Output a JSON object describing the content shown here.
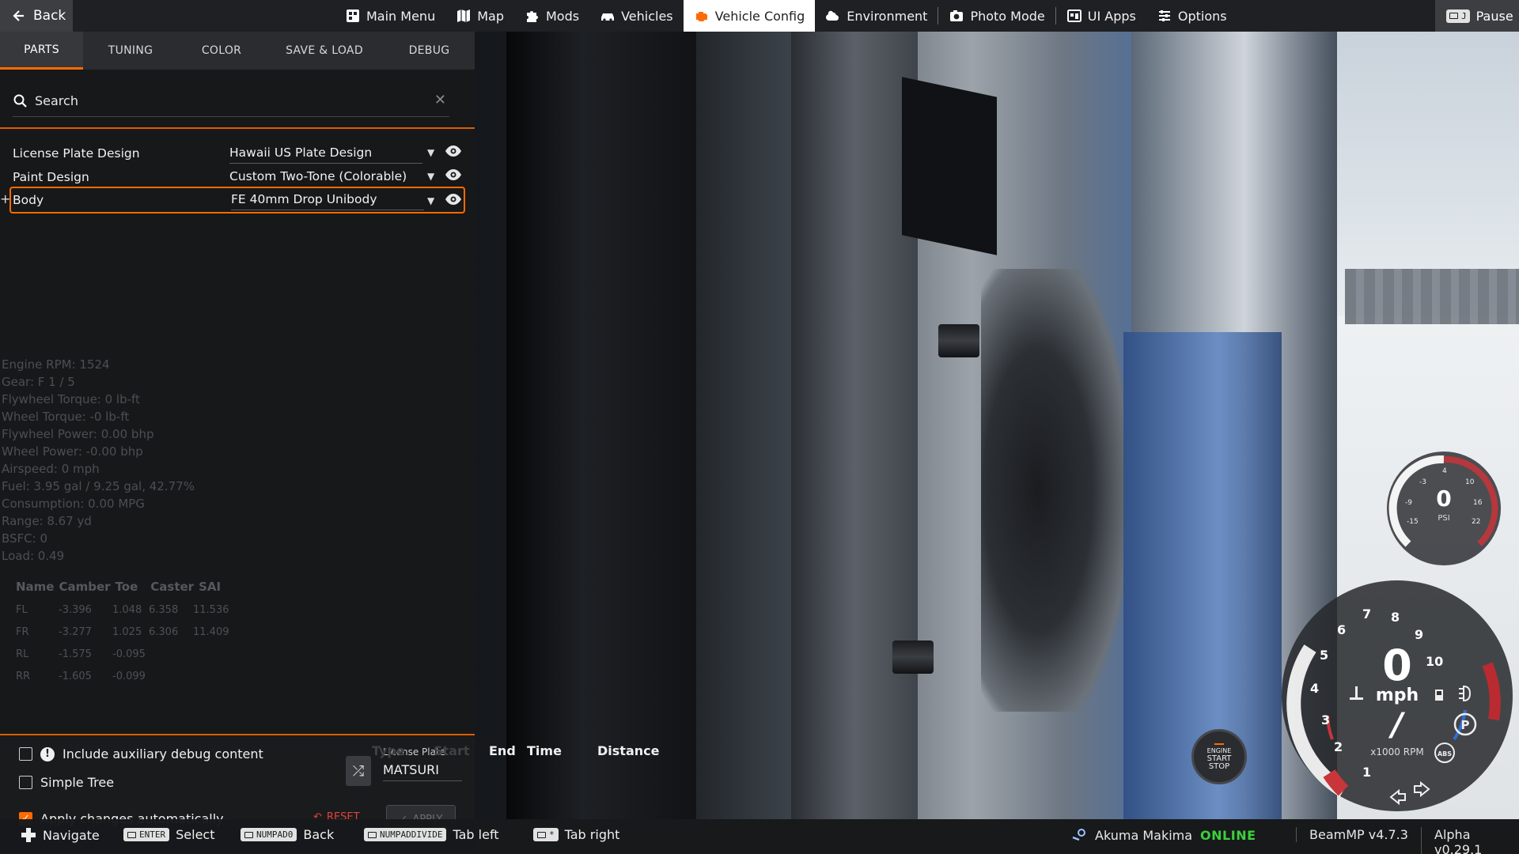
{
  "topbar": {
    "back_label": "Back",
    "menu": [
      {
        "label": "Main Menu",
        "icon": "grid-icon"
      },
      {
        "label": "Map",
        "icon": "map-icon"
      },
      {
        "label": "Mods",
        "icon": "puzzle-icon"
      },
      {
        "label": "Vehicles",
        "icon": "car-icon"
      },
      {
        "label": "Vehicle Config",
        "icon": "engine-icon"
      },
      {
        "label": "Environment",
        "icon": "weather-icon"
      },
      {
        "label": "Photo Mode",
        "icon": "camera-icon"
      },
      {
        "label": "UI Apps",
        "icon": "apps-icon"
      },
      {
        "label": "Options",
        "icon": "sliders-icon"
      }
    ],
    "active_menu": "Vehicle Config",
    "pause_label": "Pause"
  },
  "tabs": [
    "PARTS",
    "TUNING",
    "COLOR",
    "SAVE & LOAD",
    "DEBUG"
  ],
  "active_tab": "PARTS",
  "search": {
    "label": "Search"
  },
  "parts": [
    {
      "name": "License Plate Design",
      "value": "Hawaii US Plate Design"
    },
    {
      "name": "Paint Design",
      "value": "Custom Two-Tone (Colorable)"
    },
    {
      "name": "Body",
      "value": "FE 40mm Drop Unibody",
      "selected": true
    }
  ],
  "debug_lines": [
    "Engine RPM: 1524",
    "Gear: F 1 / 5",
    "Flywheel Torque: 0 lb-ft",
    "Wheel Torque: -0 lb-ft",
    "Flywheel Power: 0.00 bhp",
    "Wheel Power: -0.00 bhp",
    "Airspeed: 0 mph",
    "Fuel: 3.95 gal / 9.25 gal, 42.77%",
    "Consumption: 0.00 MPG",
    "Range: 8.67 yd",
    "BSFC: 0",
    "Load: 0.49"
  ],
  "alignment": {
    "headers": [
      "Name",
      "Camber",
      "Toe",
      "Caster",
      "SAI"
    ],
    "rows": [
      [
        "FL",
        "-3.396",
        "1.048",
        "6.358",
        "11.536"
      ],
      [
        "FR",
        "-3.277",
        "1.025",
        "6.306",
        "11.409"
      ],
      [
        "RL",
        "-1.575",
        "-0.095",
        "",
        ""
      ],
      [
        "RR",
        "-1.605",
        "-0.099",
        "",
        ""
      ]
    ]
  },
  "options": {
    "include_aux": "Include auxiliary debug content",
    "simple_tree": "Simple Tree",
    "apply_auto": "Apply changes automatically",
    "include_aux_checked": false,
    "simple_tree_checked": false,
    "apply_auto_checked": true,
    "plate_label": "License Plate",
    "plate_value": "MATSURI",
    "reset_label": "RESET",
    "apply_label": "APPLY"
  },
  "ghost_headers": [
    "Type",
    "Start",
    "End",
    "Time",
    "Distance"
  ],
  "boost_gauge": {
    "value": "0",
    "unit": "PSI",
    "ticks": [
      "-15",
      "-9",
      "-3",
      "4",
      "10",
      "16",
      "22"
    ]
  },
  "speedo": {
    "speed": "0",
    "unit": "mph",
    "gear": "/",
    "rpm_label": "x1000 RPM",
    "ticks": [
      "1",
      "2",
      "3",
      "4",
      "5",
      "6",
      "7",
      "8",
      "9",
      "10"
    ],
    "abs_label": "ABS",
    "park_label": "P"
  },
  "engine_button": {
    "line1": "ENGINE",
    "line2": "START",
    "line3": "STOP"
  },
  "bottombar": {
    "hints": [
      {
        "key": "",
        "label": "Navigate"
      },
      {
        "key": "ENTER",
        "label": "Select"
      },
      {
        "key": "NUMPAD0",
        "label": "Back"
      },
      {
        "key": "NUMPADDIVIDE",
        "label": "Tab left"
      },
      {
        "key": "*",
        "label": "Tab right"
      }
    ],
    "user": "Akuma Makima",
    "status": "ONLINE",
    "beammp": "BeamMP v4.7.3",
    "version": "Alpha v0.29.1"
  },
  "colors": {
    "accent": "#ff6a00",
    "online": "#3bd13b",
    "reset": "#e0443b"
  }
}
